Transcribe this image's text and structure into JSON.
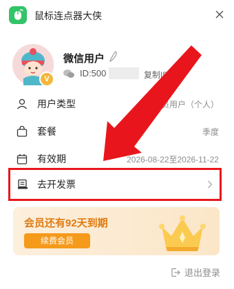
{
  "app": {
    "title": "鼠标连点器大侠"
  },
  "profile": {
    "username": "微信用户",
    "user_id": "ID:500",
    "copy_id_label": "复制ID",
    "badge": "V"
  },
  "rows": {
    "user_type": {
      "label": "用户类型",
      "value": "会员用户（个人）"
    },
    "plan": {
      "label": "套餐",
      "value": "季度"
    },
    "validity": {
      "label": "有效期",
      "value": "2026-08-22至2026-11-22"
    },
    "invoice": {
      "label": "去开发票"
    }
  },
  "vip_card": {
    "message": "会员还有92天到期",
    "renew_label": "续费会员"
  },
  "footer": {
    "logout_label": "退出登录"
  },
  "colors": {
    "brand_green": "#33c46a",
    "highlight_red": "#e8161c",
    "vip_orange": "#f59a1b"
  }
}
